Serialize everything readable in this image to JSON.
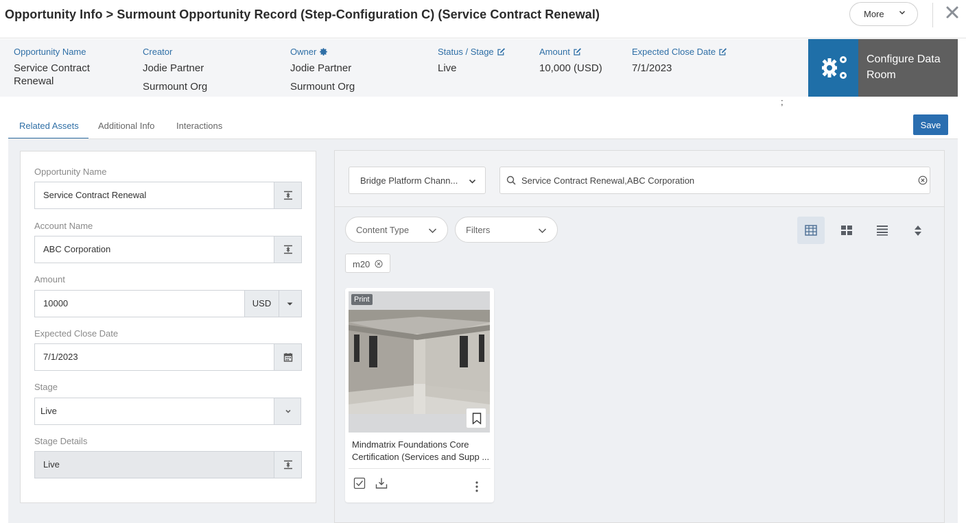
{
  "header": {
    "title": "Opportunity Info > Surmount Opportunity Record (Step-Configuration C) (Service Contract Renewal)",
    "more_label": "More"
  },
  "info": {
    "opportunity_name": {
      "label": "Opportunity Name",
      "value": "Service Contract Renewal"
    },
    "creator": {
      "label": "Creator",
      "value": "Jodie Partner",
      "org": "Surmount Org"
    },
    "owner": {
      "label": "Owner",
      "value": "Jodie Partner",
      "org": "Surmount Org"
    },
    "status": {
      "label": "Status / Stage",
      "value": "Live"
    },
    "amount": {
      "label": "Amount",
      "value": "10,000 (USD)"
    },
    "close_date": {
      "label": "Expected Close Date",
      "value": "7/1/2023"
    },
    "semicolon": ";"
  },
  "config": {
    "label": "Configure Data Room"
  },
  "tabs": [
    {
      "label": "Related Assets",
      "active": true
    },
    {
      "label": "Additional Info",
      "active": false
    },
    {
      "label": "Interactions",
      "active": false
    }
  ],
  "save_label": "Save",
  "form": {
    "opportunity_name": {
      "label": "Opportunity Name",
      "value": "Service Contract Renewal"
    },
    "account_name": {
      "label": "Account Name",
      "value": "ABC Corporation"
    },
    "amount": {
      "label": "Amount",
      "value": "10000",
      "currency": "USD"
    },
    "close_date": {
      "label": "Expected Close Date",
      "value": "7/1/2023"
    },
    "stage": {
      "label": "Stage",
      "value": "Live"
    },
    "stage_details": {
      "label": "Stage Details",
      "value": "Live"
    }
  },
  "assets": {
    "channel_dropdown": "Bridge Platform Chann...",
    "search_value": "Service Contract Renewal,ABC Corporation",
    "content_type_label": "Content Type",
    "filters_label": "Filters",
    "tag": "m20",
    "card": {
      "badge": "Print",
      "title": "Mindmatrix Foundations Core Certification (Services and Supp ..."
    }
  },
  "colors": {
    "accent": "#2f6fa6",
    "save_button": "#2a6eb0",
    "config_icon_bg": "#1f6fa8",
    "config_bg": "#5f5f5f"
  }
}
